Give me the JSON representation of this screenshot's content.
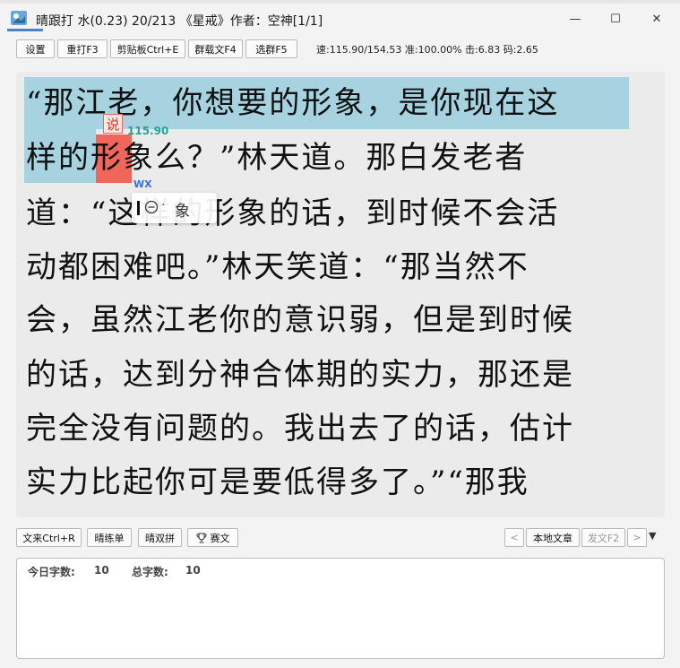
{
  "window": {
    "title": "晴跟打 水(0.23) 20/213 《星戒》作者：空神[1/1]",
    "controls": {
      "minimize": "—",
      "maximize": "☐",
      "close": "✕"
    }
  },
  "toolbar": {
    "buttons": [
      "设置",
      "重打F3",
      "剪贴板Ctrl+E",
      "群载文F4",
      "选群F5"
    ],
    "stats": "速:115.90/154.53 准:100.00% 击:6.83 码:2.65"
  },
  "text": {
    "lines": [
      "“那江老，你想要的形象，是你现在这",
      "样的形象么？”林天道。那白发老者",
      "道：“这样的形象的话，到时候不会活",
      "动都困难吧。”林天笑道：“那当然不",
      "会，虽然江老你的意识弱，但是到时候",
      "的话，达到分神合体期的实力，那还是",
      "完全没有问题的。我出去了的话，估计",
      "实力比起你可是要低得多了。”“那我"
    ],
    "hint_char": "说",
    "speed_tag": "115.90",
    "method_tag": "WX",
    "ime": {
      "dot": "·",
      "candidate": "象"
    }
  },
  "bottom_bar": {
    "left_buttons": [
      "文来Ctrl+R",
      "晴练单",
      "晴双拼",
      "赛文"
    ],
    "prev": "<",
    "local_article": "本地文章",
    "send_article": "发文F2",
    "next": ">",
    "dropdown": "▼"
  },
  "info": {
    "today_label": "今日字数:",
    "today_value": "10",
    "total_label": "总字数:",
    "total_value": "10"
  },
  "colors": {
    "typed_highlight": "#a7d3e1",
    "current_char": "#f0665a",
    "speed_tag": "#25a39a",
    "method_tag": "#3b6fd6"
  }
}
